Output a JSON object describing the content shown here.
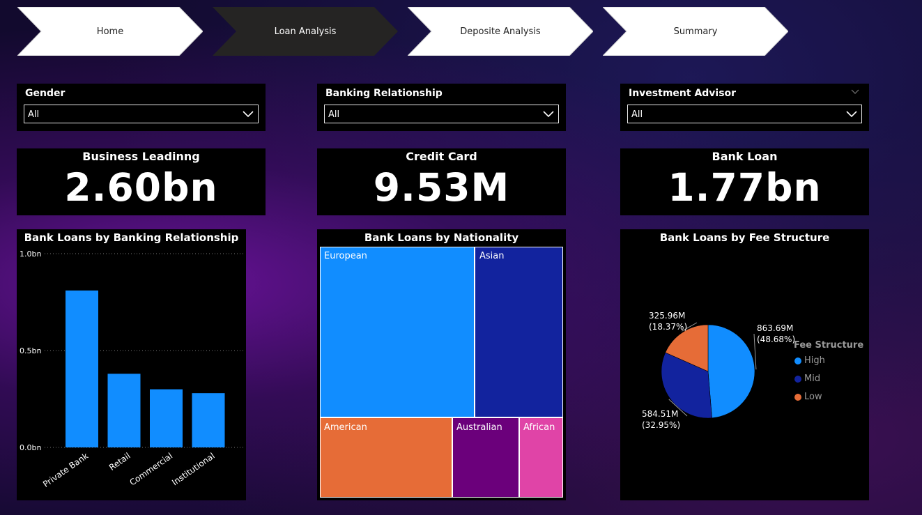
{
  "nav": {
    "tabs": [
      {
        "label": "Home",
        "active": false
      },
      {
        "label": "Loan Analysis",
        "active": true
      },
      {
        "label": "Deposite Analysis",
        "active": false
      },
      {
        "label": "Summary",
        "active": false
      }
    ]
  },
  "slicers": {
    "gender": {
      "title": "Gender",
      "value": "All"
    },
    "banking_relationship": {
      "title": "Banking Relationship",
      "value": "All"
    },
    "investment_advisor": {
      "title": "Investment Advisor",
      "value": "All"
    }
  },
  "cards": {
    "business_lending": {
      "title": "Business Leadinng",
      "value": "2.60bn"
    },
    "credit_card": {
      "title": "Credit Card",
      "value": "9.53M"
    },
    "bank_loan": {
      "title": "Bank Loan",
      "value": "1.77bn"
    }
  },
  "colors": {
    "high": "#118DFF",
    "mid": "#12239E",
    "low": "#E66C37",
    "australian": "#6B007B",
    "african": "#E044A7"
  },
  "chart_data": [
    {
      "type": "bar",
      "title": "Bank Loans by Banking Relationship",
      "categories": [
        "Private Bank",
        "Retail",
        "Commercial",
        "Institutional"
      ],
      "values": [
        0.81,
        0.38,
        0.3,
        0.28
      ],
      "y_ticks": [
        "0.0bn",
        "0.5bn",
        "1.0bn"
      ],
      "ylim": [
        0,
        1.0
      ],
      "grid": true,
      "color": "#118DFF"
    },
    {
      "type": "treemap",
      "title": "Bank Loans by Nationality",
      "labels": [
        "European",
        "Asian",
        "American",
        "Australian",
        "African"
      ]
    },
    {
      "type": "pie",
      "title": "Bank Loans by Fee Structure",
      "legend_title": "Fee Structure",
      "legend_position": "right",
      "slices": [
        {
          "name": "High",
          "value": 863.69,
          "value_label": "863.69M",
          "pct_label": "(48.68%)"
        },
        {
          "name": "Mid",
          "value": 584.51,
          "value_label": "584.51M",
          "pct_label": "(32.95%)"
        },
        {
          "name": "Low",
          "value": 325.96,
          "value_label": "325.96M",
          "pct_label": "(18.37%)"
        }
      ]
    }
  ]
}
